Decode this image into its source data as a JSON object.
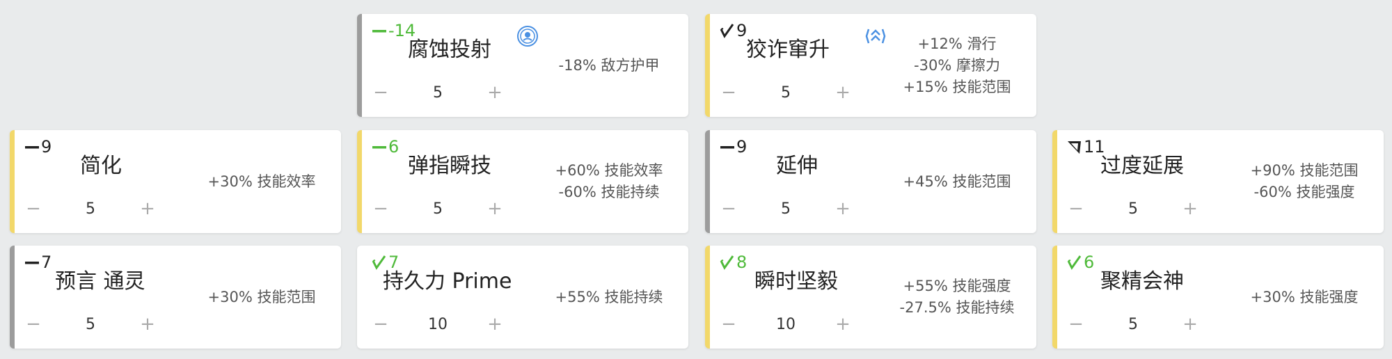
{
  "colors": {
    "accent_gold": "#f2d86a",
    "accent_gray": "#9c9c9c",
    "drain_green": "#4fba3a",
    "aura_blue": "#4a90e2"
  },
  "cards": [
    {
      "name": "腐蚀投射",
      "drain": "-14",
      "polarity_icon": "dash-polarity-icon",
      "aura_icon": "aura-icon",
      "rank": "5",
      "stats": [
        "-18% 敌方护甲"
      ]
    },
    {
      "name": "狡诈窜升",
      "drain": "9",
      "polarity_icon": "madurai-polarity-icon",
      "aura_icon": "exilus-icon",
      "rank": "5",
      "stats": [
        "+12% 滑行",
        "-30% 摩擦力",
        "+15% 技能范围"
      ]
    },
    {
      "name": "简化",
      "drain": "9",
      "polarity_icon": "dash-polarity-icon",
      "rank": "5",
      "stats": [
        "+30% 技能效率"
      ]
    },
    {
      "name": "弹指瞬技",
      "drain": "6",
      "polarity_icon": "dash-polarity-icon",
      "rank": "5",
      "stats": [
        "+60% 技能效率",
        "-60% 技能持续"
      ]
    },
    {
      "name": "延伸",
      "drain": "9",
      "polarity_icon": "dash-polarity-icon",
      "rank": "5",
      "stats": [
        "+45% 技能范围"
      ]
    },
    {
      "name": "过度延展",
      "drain": "11",
      "polarity_icon": "vazarin-polarity-icon",
      "rank": "5",
      "stats": [
        "+90% 技能范围",
        "-60% 技能强度"
      ]
    },
    {
      "name": "预言 通灵",
      "drain": "7",
      "polarity_icon": "dash-polarity-icon",
      "rank": "5",
      "stats": [
        "+30% 技能范围"
      ]
    },
    {
      "name": "持久力 Prime",
      "drain": "7",
      "polarity_icon": "madurai-polarity-icon",
      "rank": "10",
      "stats": [
        "+55% 技能持续"
      ]
    },
    {
      "name": "瞬时坚毅",
      "drain": "8",
      "polarity_icon": "madurai-polarity-icon",
      "rank": "10",
      "stats": [
        "+55% 技能强度",
        "-27.5% 技能持续"
      ]
    },
    {
      "name": "聚精会神",
      "drain": "6",
      "polarity_icon": "madurai-polarity-icon",
      "rank": "5",
      "stats": [
        "+30% 技能强度"
      ]
    }
  ],
  "controls": {
    "minus": "−",
    "plus": "+"
  }
}
